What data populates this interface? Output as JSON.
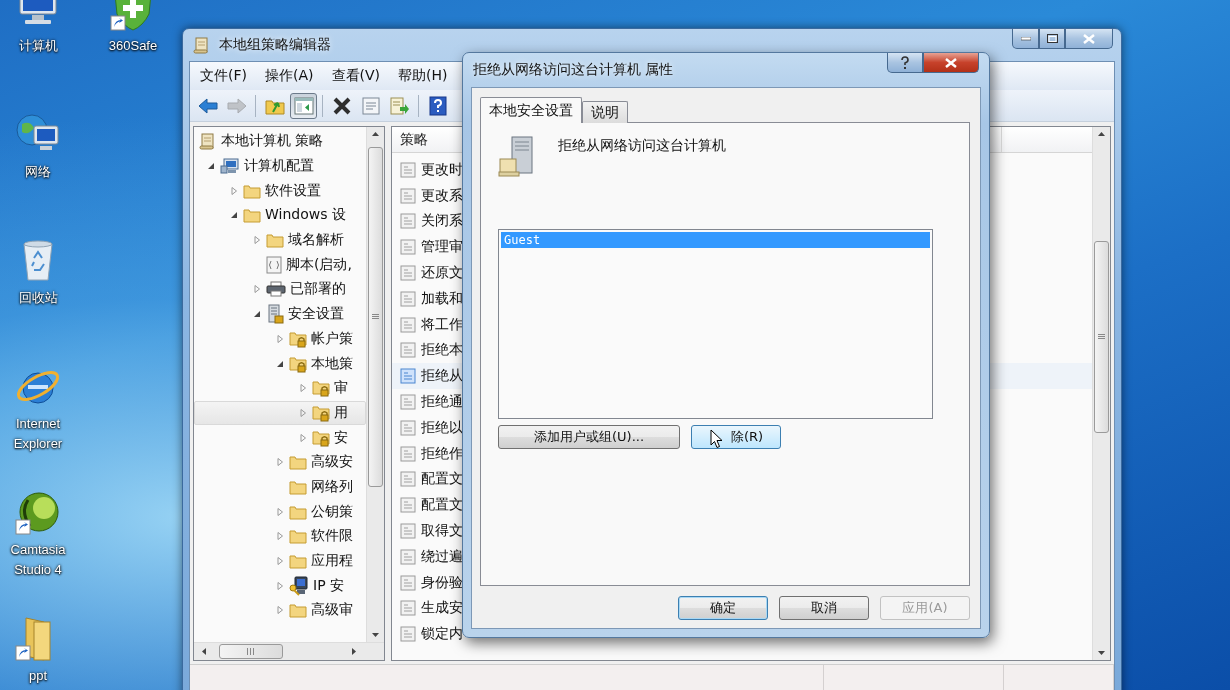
{
  "desktop_icons": [
    {
      "label": "计算机",
      "kind": "computer",
      "shortcut": false
    },
    {
      "label": "360Safe",
      "kind": "shield",
      "shortcut": true
    },
    {
      "label": "网络",
      "kind": "network",
      "shortcut": false
    },
    {
      "label": "回收站",
      "kind": "recycle",
      "shortcut": false
    },
    {
      "label": "Internet Explorer",
      "kind": "browser",
      "shortcut": false
    },
    {
      "label": "Camtasia Studio 4",
      "kind": "sphere",
      "shortcut": true
    },
    {
      "label": "ppt",
      "kind": "folder",
      "shortcut": true
    }
  ],
  "main_window": {
    "title": "本地组策略编辑器",
    "menu": [
      "文件(F)",
      "操作(A)",
      "查看(V)",
      "帮助(H)"
    ],
    "toolbar": [
      [
        {
          "kind": "back",
          "disabled": false,
          "pressed": false
        },
        {
          "kind": "forward",
          "disabled": true,
          "pressed": false
        }
      ],
      [
        {
          "kind": "up",
          "disabled": false,
          "pressed": false
        },
        {
          "kind": "tree",
          "disabled": false,
          "pressed": true
        }
      ],
      [
        {
          "kind": "delete",
          "disabled": false,
          "pressed": false
        },
        {
          "kind": "properties",
          "disabled": false,
          "pressed": false
        },
        {
          "kind": "export",
          "disabled": false,
          "pressed": false
        }
      ],
      [
        {
          "kind": "help",
          "disabled": false,
          "pressed": false
        }
      ]
    ],
    "tree": [
      {
        "label": "本地计算机 策略",
        "kind": "scroll",
        "expandable": false,
        "selected": false,
        "children": [
          {
            "label": "计算机配置",
            "kind": "computer",
            "expandable": true,
            "expanded": true,
            "selected": false,
            "children": [
              {
                "label": "软件设置",
                "kind": "folder",
                "expandable": true,
                "expanded": false,
                "selected": false
              },
              {
                "label": "Windows 设",
                "kind": "folder",
                "expandable": true,
                "expanded": true,
                "selected": false,
                "children": [
                  {
                    "label": "域名解析",
                    "kind": "folder",
                    "expandable": true,
                    "expanded": false,
                    "selected": false
                  },
                  {
                    "label": "脚本(启动,",
                    "kind": "script",
                    "expandable": false,
                    "selected": false
                  },
                  {
                    "label": "已部署的",
                    "kind": "printer",
                    "expandable": true,
                    "expanded": false,
                    "selected": false
                  },
                  {
                    "label": "安全设置",
                    "kind": "server",
                    "expandable": true,
                    "expanded": true,
                    "selected": false,
                    "children": [
                      {
                        "label": "帐户策",
                        "kind": "lock-folder",
                        "expandable": true,
                        "expanded": false,
                        "selected": false
                      },
                      {
                        "label": "本地策",
                        "kind": "lock-folder",
                        "expandable": true,
                        "expanded": true,
                        "selected": false,
                        "children": [
                          {
                            "label": "审",
                            "kind": "lock-folder",
                            "expandable": true,
                            "expanded": false,
                            "selected": false
                          },
                          {
                            "label": "用",
                            "kind": "lock-folder",
                            "expandable": true,
                            "expanded": false,
                            "selected": true
                          },
                          {
                            "label": "安",
                            "kind": "lock-folder",
                            "expandable": true,
                            "expanded": false,
                            "selected": false
                          }
                        ]
                      },
                      {
                        "label": "高级安",
                        "kind": "folder",
                        "expandable": true,
                        "expanded": false,
                        "selected": false
                      },
                      {
                        "label": "网络列",
                        "kind": "folder",
                        "expandable": false,
                        "selected": false
                      },
                      {
                        "label": "公钥策",
                        "kind": "folder",
                        "expandable": true,
                        "expanded": false,
                        "selected": false
                      },
                      {
                        "label": "软件限",
                        "kind": "folder",
                        "expandable": true,
                        "expanded": false,
                        "selected": false
                      },
                      {
                        "label": "应用程",
                        "kind": "folder",
                        "expandable": true,
                        "expanded": false,
                        "selected": false
                      },
                      {
                        "label": "IP 安",
                        "kind": "ip",
                        "expandable": true,
                        "expanded": false,
                        "selected": false
                      },
                      {
                        "label": "高级审",
                        "kind": "folder",
                        "expandable": true,
                        "expanded": false,
                        "selected": false
                      }
                    ]
                  }
                ]
              }
            ]
          }
        ]
      }
    ],
    "list": {
      "columns": [
        "策略"
      ],
      "rows": [
        {
          "label": "更改时",
          "selected": false
        },
        {
          "label": "更改系",
          "selected": false
        },
        {
          "label": "关闭系",
          "selected": false
        },
        {
          "label": "管理审",
          "selected": false
        },
        {
          "label": "还原文",
          "selected": false
        },
        {
          "label": "加载和",
          "selected": false
        },
        {
          "label": "将工作",
          "selected": false
        },
        {
          "label": "拒绝本",
          "selected": false
        },
        {
          "label": "拒绝从",
          "selected": true
        },
        {
          "label": "拒绝通",
          "selected": false
        },
        {
          "label": "拒绝以",
          "selected": false
        },
        {
          "label": "拒绝作",
          "selected": false
        },
        {
          "label": "配置文",
          "selected": false
        },
        {
          "label": "配置文",
          "selected": false
        },
        {
          "label": "取得文",
          "selected": false
        },
        {
          "label": "绕过遍",
          "selected": false
        },
        {
          "label": "身份验",
          "selected": false
        },
        {
          "label": "生成安",
          "selected": false
        },
        {
          "label": "锁定内",
          "selected": false
        }
      ]
    }
  },
  "dialog": {
    "title": "拒绝从网络访问这台计算机 属性",
    "tabs": [
      {
        "label": "本地安全设置",
        "selected": true
      },
      {
        "label": "说明",
        "selected": false
      }
    ],
    "heading": "拒绝从网络访问这台计算机",
    "members": [
      {
        "name": "Guest",
        "selected": true
      }
    ],
    "member_buttons": [
      {
        "label": "添加用户或组(U)...",
        "hovered": false,
        "pointer": false
      },
      {
        "label": "除(R)",
        "hovered": true,
        "pointer": true
      }
    ],
    "buttons": [
      {
        "label": "确定",
        "default": true,
        "disabled": false
      },
      {
        "label": "取消",
        "default": false,
        "disabled": false
      },
      {
        "label": "应用(A)",
        "default": false,
        "disabled": true
      }
    ]
  }
}
